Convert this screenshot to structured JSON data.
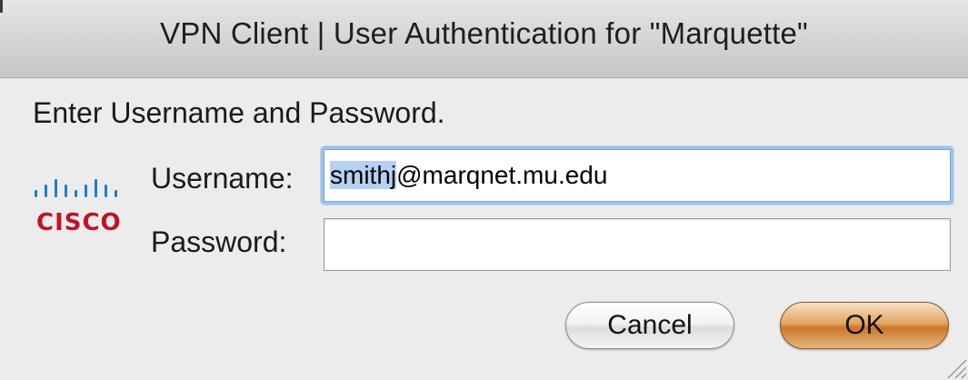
{
  "window": {
    "title": "VPN Client  |  User Authentication for \"Marquette\""
  },
  "dialog": {
    "prompt": "Enter Username and Password.",
    "logo_text": "CISCO",
    "username_label": "Username:",
    "username_value_selected": "smithj",
    "username_value_rest": "@marqnet.mu.edu",
    "password_label": "Password:",
    "password_value": ""
  },
  "buttons": {
    "cancel_label": "Cancel",
    "ok_label": "OK"
  },
  "colors": {
    "brand_red": "#c11226",
    "logo_blue": "#1b7fc4",
    "selection": "#b5d0f0",
    "focus_ring": "#9fc2ec",
    "default_button": "#d98a40"
  },
  "icons": {
    "logo": "cisco-logo-icon",
    "resize": "resize-grip-icon"
  }
}
